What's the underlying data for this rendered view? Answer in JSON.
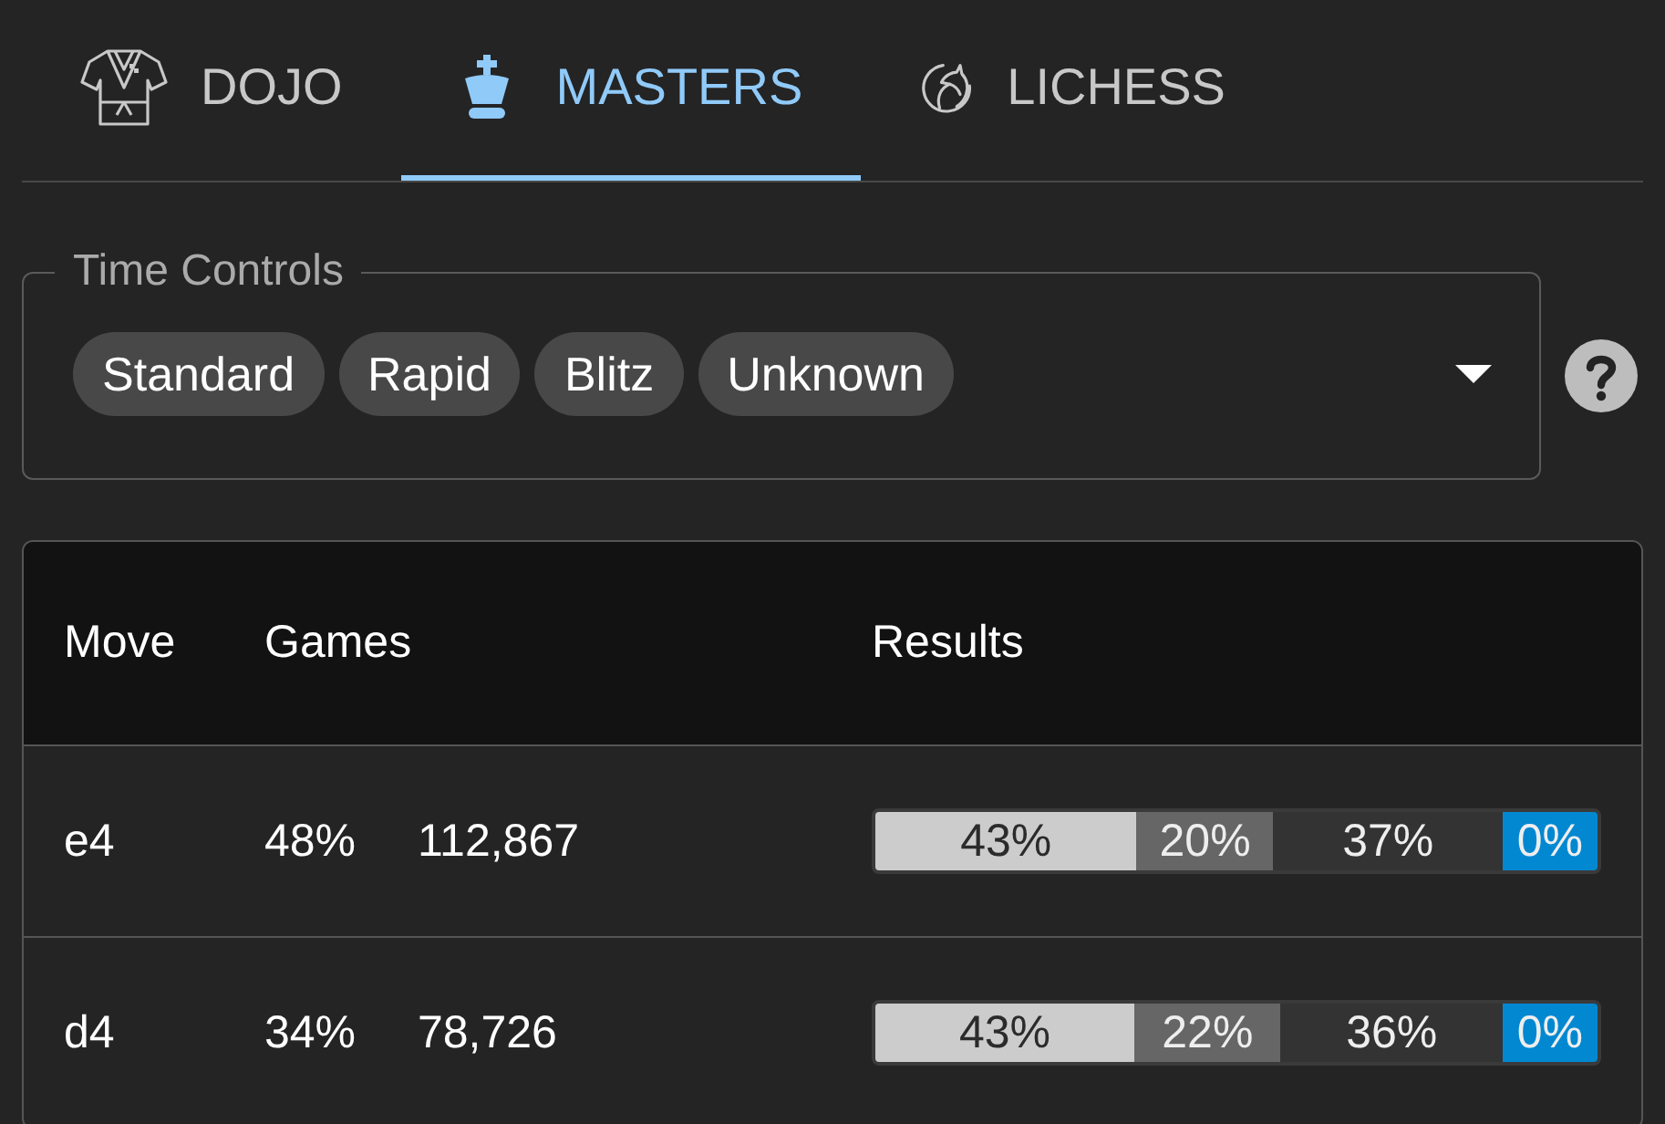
{
  "tabs": [
    {
      "label": "DOJO",
      "selected": false
    },
    {
      "label": "MASTERS",
      "selected": true
    },
    {
      "label": "LICHESS",
      "selected": false
    }
  ],
  "time_controls": {
    "label": "Time Controls",
    "chips": [
      "Standard",
      "Rapid",
      "Blitz",
      "Unknown"
    ]
  },
  "table": {
    "columns": [
      "Move",
      "Games",
      "Results"
    ],
    "rows": [
      {
        "move": "e4",
        "share": "48%",
        "games": "112,867",
        "results": [
          {
            "label": "43%",
            "color": "#cccccc"
          },
          {
            "label": "20%",
            "color": "#666666"
          },
          {
            "label": "37%",
            "color": "#333333"
          },
          {
            "label": "0%",
            "color": "#0288d1"
          }
        ]
      },
      {
        "move": "d4",
        "share": "34%",
        "games": "78,726",
        "results": [
          {
            "label": "43%",
            "color": "#cccccc"
          },
          {
            "label": "22%",
            "color": "#666666"
          },
          {
            "label": "36%",
            "color": "#333333"
          },
          {
            "label": "0%",
            "color": "#0288d1"
          }
        ]
      }
    ]
  }
}
